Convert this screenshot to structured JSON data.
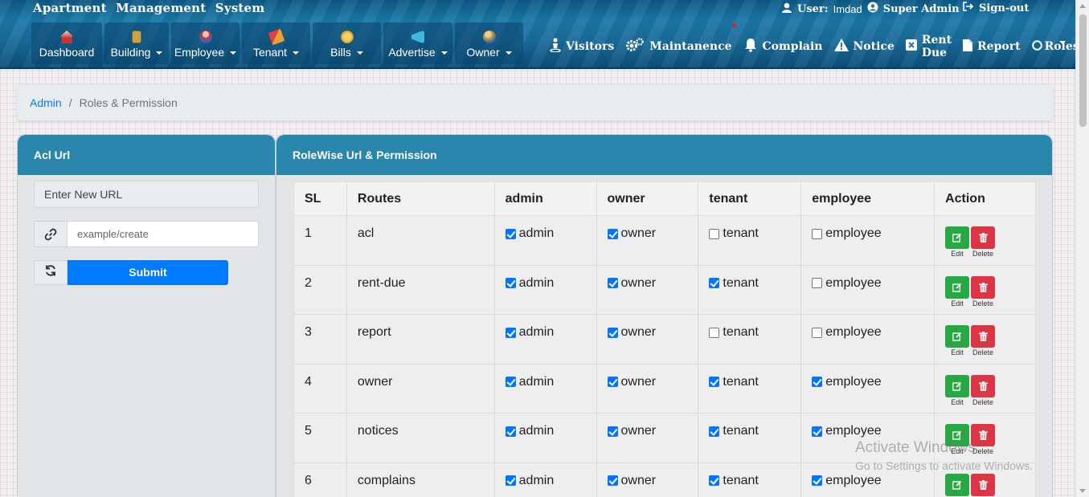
{
  "app": {
    "title": "Apartment Management System"
  },
  "user": {
    "label": "User:",
    "name": "Imdad",
    "role": "Super Admin",
    "signout": "Sign-out"
  },
  "nav": [
    {
      "label": "Dashboard",
      "icon": "house-icon",
      "caret": false
    },
    {
      "label": "Building",
      "icon": "building-icon",
      "caret": true
    },
    {
      "label": "Employee",
      "icon": "employee-icon",
      "caret": true
    },
    {
      "label": "Tenant",
      "icon": "tenant-icon",
      "caret": true
    },
    {
      "label": "Bills",
      "icon": "coins-icon",
      "caret": true
    },
    {
      "label": "Advertise",
      "icon": "megaphone-icon",
      "caret": true
    },
    {
      "label": "Owner",
      "icon": "owner-icon",
      "caret": true
    }
  ],
  "right_nav": [
    {
      "label": "Visitors",
      "icon": "visitor-icon"
    },
    {
      "label": "Maintanence",
      "icon": "gears-icon"
    },
    {
      "label": "Complain",
      "icon": "bell-icon"
    },
    {
      "label": "Notice",
      "icon": "warning-icon"
    },
    {
      "label": "Rent Due",
      "icon": "close-box-icon"
    },
    {
      "label": "Report",
      "icon": "file-icon"
    },
    {
      "label": "Roles",
      "icon": "circle-icon"
    }
  ],
  "breadcrumb": {
    "root": "Admin",
    "separator": "/",
    "current": "Roles & Permission"
  },
  "acl": {
    "title": "Acl Url",
    "new_url_label": "Enter New URL",
    "url_placeholder": "example/create",
    "submit": "Submit"
  },
  "permissions": {
    "title": "RoleWise Url & Permission",
    "headers": [
      "SL",
      "Routes",
      "admin",
      "owner",
      "tenant",
      "employee",
      "Action"
    ],
    "roles": [
      "admin",
      "owner",
      "tenant",
      "employee"
    ],
    "edit_label": "Edit",
    "delete_label": "Delete",
    "rows": [
      {
        "sl": "1",
        "route": "acl",
        "checks": [
          true,
          true,
          false,
          false
        ]
      },
      {
        "sl": "2",
        "route": "rent-due",
        "checks": [
          true,
          true,
          true,
          false
        ]
      },
      {
        "sl": "3",
        "route": "report",
        "checks": [
          true,
          true,
          false,
          false
        ]
      },
      {
        "sl": "4",
        "route": "owner",
        "checks": [
          true,
          true,
          true,
          true
        ]
      },
      {
        "sl": "5",
        "route": "notices",
        "checks": [
          true,
          true,
          true,
          true
        ]
      },
      {
        "sl": "6",
        "route": "complains",
        "checks": [
          true,
          true,
          true,
          true
        ]
      }
    ]
  },
  "watermark": {
    "line1": "Activate Windows",
    "line2": "Go to Settings to activate Windows."
  },
  "colors": {
    "header_bg": "#1b78a8",
    "card_head": "#2a86ad",
    "primary": "#007bff",
    "success": "#28a745",
    "danger": "#dc3545"
  }
}
